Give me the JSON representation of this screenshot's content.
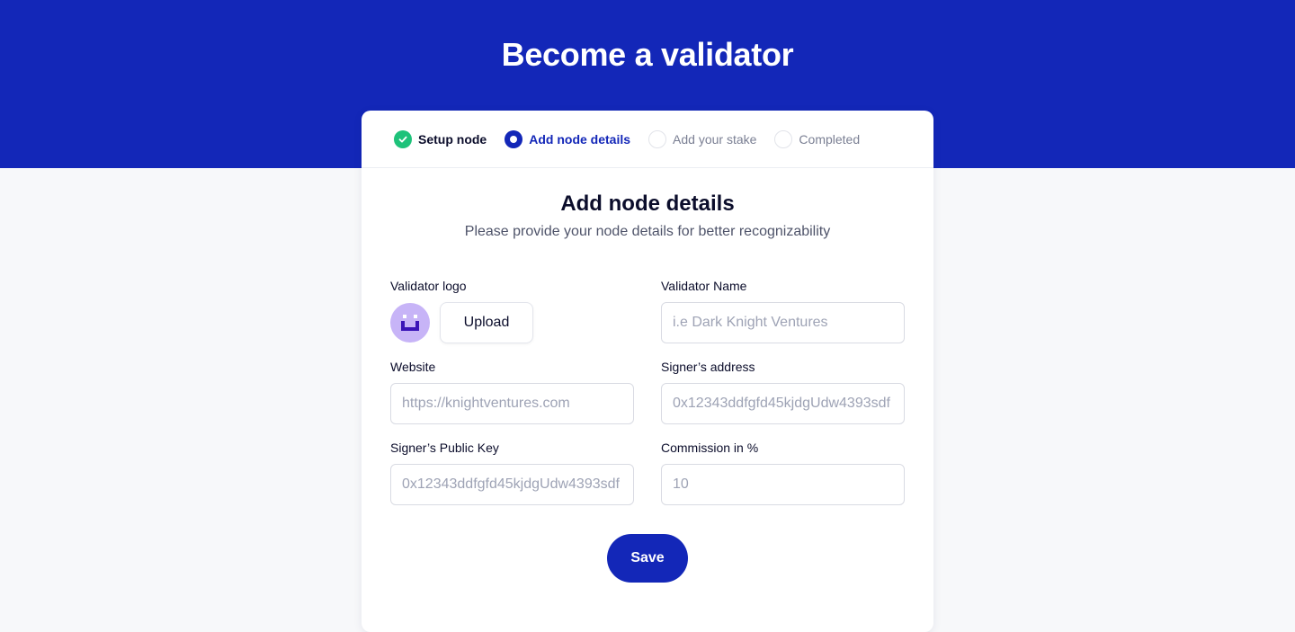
{
  "page": {
    "title": "Become a validator"
  },
  "stepper": {
    "steps": [
      {
        "label": "Setup node",
        "state": "done"
      },
      {
        "label": "Add node details",
        "state": "active"
      },
      {
        "label": "Add your stake",
        "state": "todo"
      },
      {
        "label": "Completed",
        "state": "todo"
      }
    ]
  },
  "card": {
    "title": "Add node details",
    "subtitle": "Please provide your node details for better recognizability"
  },
  "form": {
    "logo": {
      "label": "Validator logo",
      "upload_label": "Upload",
      "icon": "validator-avatar-icon"
    },
    "validator_name": {
      "label": "Validator Name",
      "placeholder": "i.e Dark Knight Ventures"
    },
    "website": {
      "label": "Website",
      "placeholder": "https://knightventures.com"
    },
    "signer_address": {
      "label": "Signer’s address",
      "placeholder": "0x12343ddfgfd45kjdgUdw4393sdf"
    },
    "signer_public_key": {
      "label": "Signer’s Public Key",
      "placeholder": "0x12343ddfgfd45kjdgUdw4393sdf"
    },
    "commission": {
      "label": "Commission in %",
      "placeholder": "10"
    },
    "save_label": "Save"
  },
  "colors": {
    "primary": "#1327b8",
    "success": "#1ec27a",
    "avatar_bg": "#c7b4f7",
    "page_bg": "#f7f8fa"
  }
}
